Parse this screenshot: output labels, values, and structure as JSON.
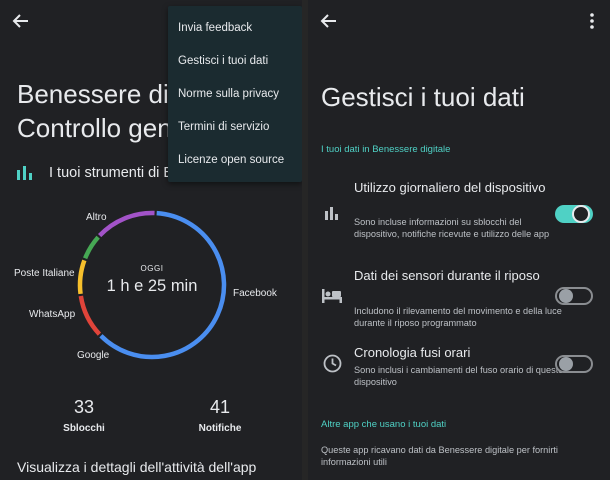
{
  "left": {
    "title_line1": "Benessere dig",
    "title_line2": "Controllo gen",
    "tools_label": "I tuoi strumenti di B",
    "menu": [
      "Invia feedback",
      "Gestisci i tuoi dati",
      "Norme sulla privacy",
      "Termini di servizio",
      "Licenze open source"
    ],
    "donut": {
      "center_label": "OGGI",
      "center_value": "1 h e 25 min",
      "segments": [
        {
          "name": "Facebook",
          "color": "#4a8ef0",
          "fraction": 0.62
        },
        {
          "name": "Google",
          "color": "#e0443a",
          "fraction": 0.1
        },
        {
          "name": "WhatsApp",
          "color": "#f7c02c",
          "fraction": 0.08
        },
        {
          "name": "Poste Italiane",
          "color": "#46a854",
          "fraction": 0.06
        },
        {
          "name": "Altro",
          "color": "#a253c8",
          "fraction": 0.14
        }
      ]
    },
    "stats": [
      {
        "value": "33",
        "label": "Sblocchi"
      },
      {
        "value": "41",
        "label": "Notifiche"
      }
    ],
    "activity_link": "Visualizza i dettagli dell'attività dell'app"
  },
  "right": {
    "title": "Gestisci i tuoi dati",
    "section1": "I tuoi dati in Benessere digitale",
    "settings": [
      {
        "title": "Utilizzo giornaliero del dispositivo",
        "desc": "Sono incluse informazioni su sblocchi del dispositivo, notifiche ricevute e utilizzo delle app",
        "enabled": true,
        "icon": "bar-chart-icon"
      },
      {
        "title": "Dati dei sensori durante il riposo",
        "desc": "Includono il rilevamento del movimento e della luce durante il riposo programmato",
        "enabled": false,
        "icon": "bed-icon"
      },
      {
        "title": "Cronologia fusi orari",
        "desc": "Sono inclusi i cambiamenti del fuso orario di questo dispositivo",
        "enabled": false,
        "icon": "clock-icon"
      }
    ],
    "section2": "Altre app che usano i tuoi dati",
    "footer_desc": "Queste app ricavano dati da Benessere digitale per fornirti informazioni utili"
  },
  "colors": {
    "accent": "#4fd1c5",
    "background": "#202124"
  }
}
